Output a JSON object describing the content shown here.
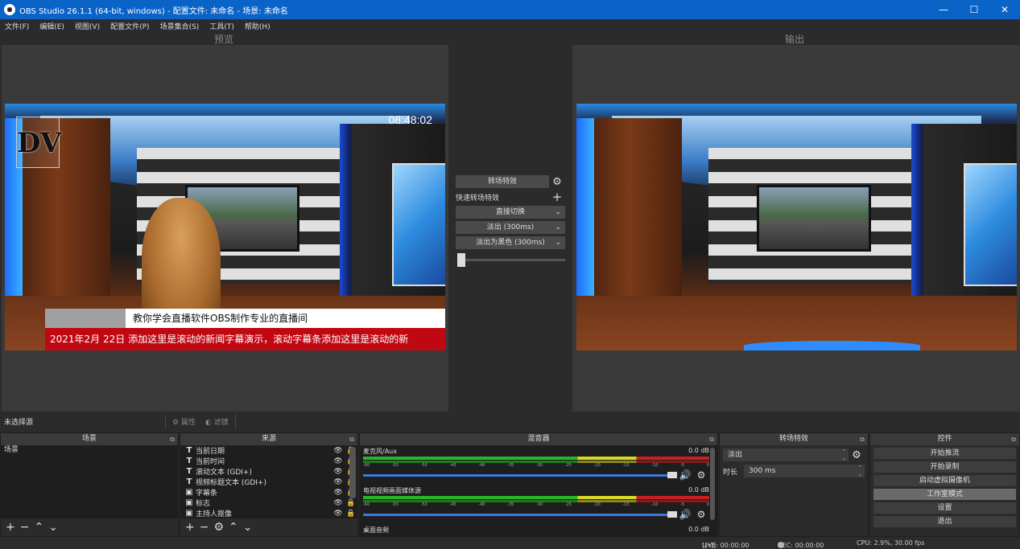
{
  "window": {
    "title": "OBS Studio 26.1.1 (64-bit, windows) - 配置文件: 未命名 - 场景: 未命名",
    "minimize": "—",
    "maximize": "☐",
    "close": "✕"
  },
  "menu": [
    "文件(F)",
    "编辑(E)",
    "视图(V)",
    "配置文件(P)",
    "场景集合(S)",
    "工具(T)",
    "帮助(H)"
  ],
  "preview_label": "预览",
  "output_label": "输出",
  "scene_overlay": {
    "logo": "DV",
    "clock": "08:48:02",
    "headline": "教你学会直播软件OBS制作专业的直播间",
    "ticker_date": "2021年2月 22日",
    "ticker_text": "添加这里是滚动的新闻字幕演示，滚动字幕条添加这里是滚动的新"
  },
  "transition_panel": {
    "transition_button": "转场特效",
    "quick_label": "快速转场特效",
    "items": [
      "直接切换",
      "淡出 (300ms)",
      "淡出为黑色 (300ms)"
    ],
    "slider_value": 0
  },
  "status_line": {
    "no_selection": "未选择源",
    "properties": "属性",
    "filters": "滤镜"
  },
  "docks": {
    "scenes": {
      "title": "场景",
      "items": [
        "场景"
      ]
    },
    "sources": {
      "title": "来源",
      "items": [
        {
          "type": "T",
          "name": "当前日期"
        },
        {
          "type": "T",
          "name": "当前时间"
        },
        {
          "type": "T",
          "name": "滚动文本 (GDI+)"
        },
        {
          "type": "T",
          "name": "视频标题文本 (GDI+)"
        },
        {
          "type": "▣",
          "name": "字幕条"
        },
        {
          "type": "▣",
          "name": "标志"
        },
        {
          "type": "▣",
          "name": "主持人抠像"
        }
      ]
    },
    "mixer": {
      "title": "混音器",
      "channels": [
        {
          "name": "麦克风/Aux",
          "db": "0.0 dB"
        },
        {
          "name": "电视视频画面媒体源",
          "db": "0.0 dB"
        },
        {
          "name": "桌面音频",
          "db": "0.0 dB"
        }
      ],
      "ticks": [
        "-60",
        "-55",
        "-50",
        "-45",
        "-40",
        "-35",
        "-30",
        "-25",
        "-20",
        "-15",
        "-10",
        "-5",
        "0"
      ]
    },
    "transitions": {
      "title": "转场特效",
      "selected": "淡出",
      "duration_label": "时长",
      "duration_value": "300 ms"
    },
    "controls": {
      "title": "控件",
      "buttons": [
        "开始推流",
        "开始录制",
        "启动虚拟摄像机",
        "工作室模式",
        "设置",
        "退出"
      ],
      "active_index": 3
    }
  },
  "statusbar": {
    "live": "LIVE: 00:00:00",
    "rec": "REC: 00:00:00",
    "cpu": "CPU: 2.9%, 30.00 fps"
  },
  "colors": {
    "titlebar": "#0a64c8",
    "ticker": "#c00812",
    "background": "#2b2b2b"
  }
}
